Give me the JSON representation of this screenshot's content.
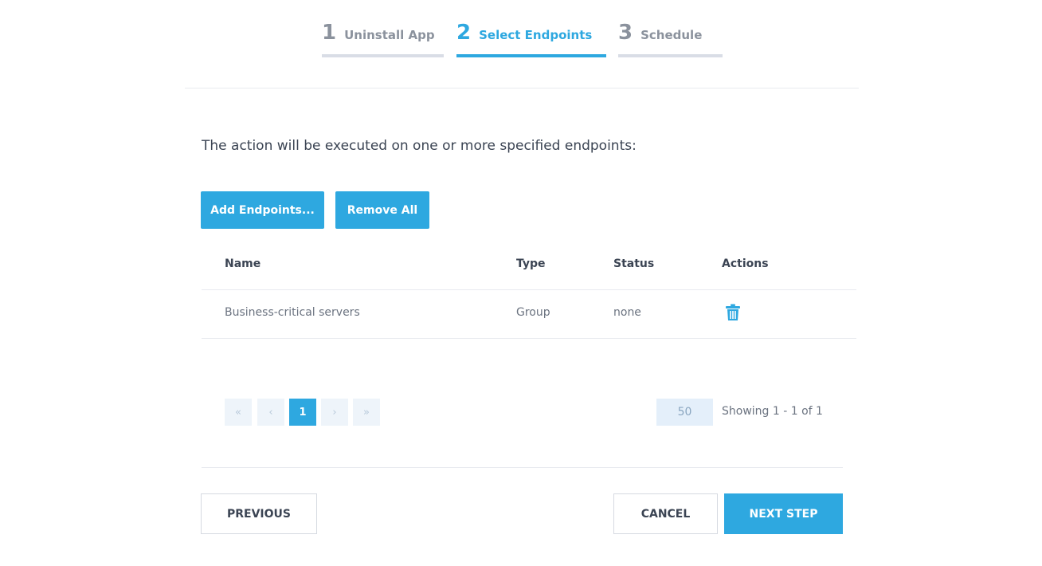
{
  "wizard": {
    "steps": [
      {
        "number": "1",
        "label": "Uninstall App"
      },
      {
        "number": "2",
        "label": "Select Endpoints"
      },
      {
        "number": "3",
        "label": "Schedule"
      }
    ],
    "active_step": 2
  },
  "intro_text": "The action will be executed on one or more specified endpoints:",
  "toolbar": {
    "add_label": "Add Endpoints...",
    "remove_all_label": "Remove All"
  },
  "table": {
    "headers": {
      "name": "Name",
      "type": "Type",
      "status": "Status",
      "actions": "Actions"
    },
    "rows": [
      {
        "name": "Business-critical servers",
        "type": "Group",
        "status": "none",
        "action_icon": "trash-icon"
      }
    ]
  },
  "pagination": {
    "first": "«",
    "prev": "‹",
    "current_page": "1",
    "next": "›",
    "last": "»",
    "per_page": "50",
    "showing": "Showing 1 - 1 of 1"
  },
  "footer": {
    "previous_label": "PREVIOUS",
    "cancel_label": "CANCEL",
    "next_label": "NEXT STEP"
  },
  "colors": {
    "accent": "#2ea8e0",
    "text": "#3b4453",
    "muted": "#8b929d"
  }
}
